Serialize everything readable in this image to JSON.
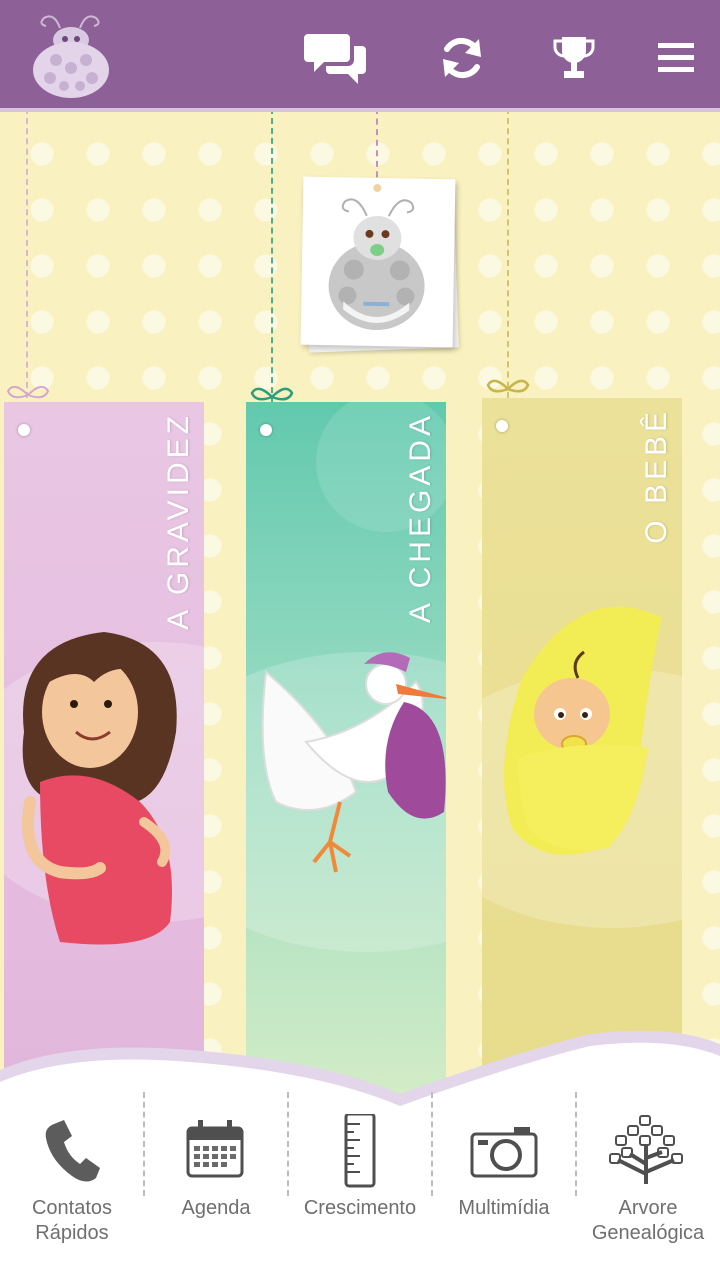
{
  "header": {
    "logo_icon": "ladybug-logo-icon",
    "actions": [
      {
        "name": "chat-icon"
      },
      {
        "name": "refresh-icon"
      },
      {
        "name": "trophy-icon"
      },
      {
        "name": "menu-icon"
      }
    ],
    "color": "#8d6097"
  },
  "photo": {
    "icon": "baby-ladybug-icon"
  },
  "cards": [
    {
      "label": "A GRAVIDEZ",
      "color": "#e7bfe0",
      "illustration": "pregnant-woman-illustration"
    },
    {
      "label": "A CHEGADA",
      "color": "#8fd6bf",
      "illustration": "stork-illustration"
    },
    {
      "label": "O BEBÊ",
      "color": "#eee49a",
      "illustration": "baby-in-blanket-illustration"
    }
  ],
  "nav": [
    {
      "label": "Contatos Rápidos",
      "icon": "phone-icon"
    },
    {
      "label": "Agenda",
      "icon": "calendar-icon"
    },
    {
      "label": "Crescimento",
      "icon": "ruler-icon"
    },
    {
      "label": "Multimídia",
      "icon": "camera-icon"
    },
    {
      "label": "Arvore Genealógica",
      "icon": "family-tree-icon"
    }
  ]
}
